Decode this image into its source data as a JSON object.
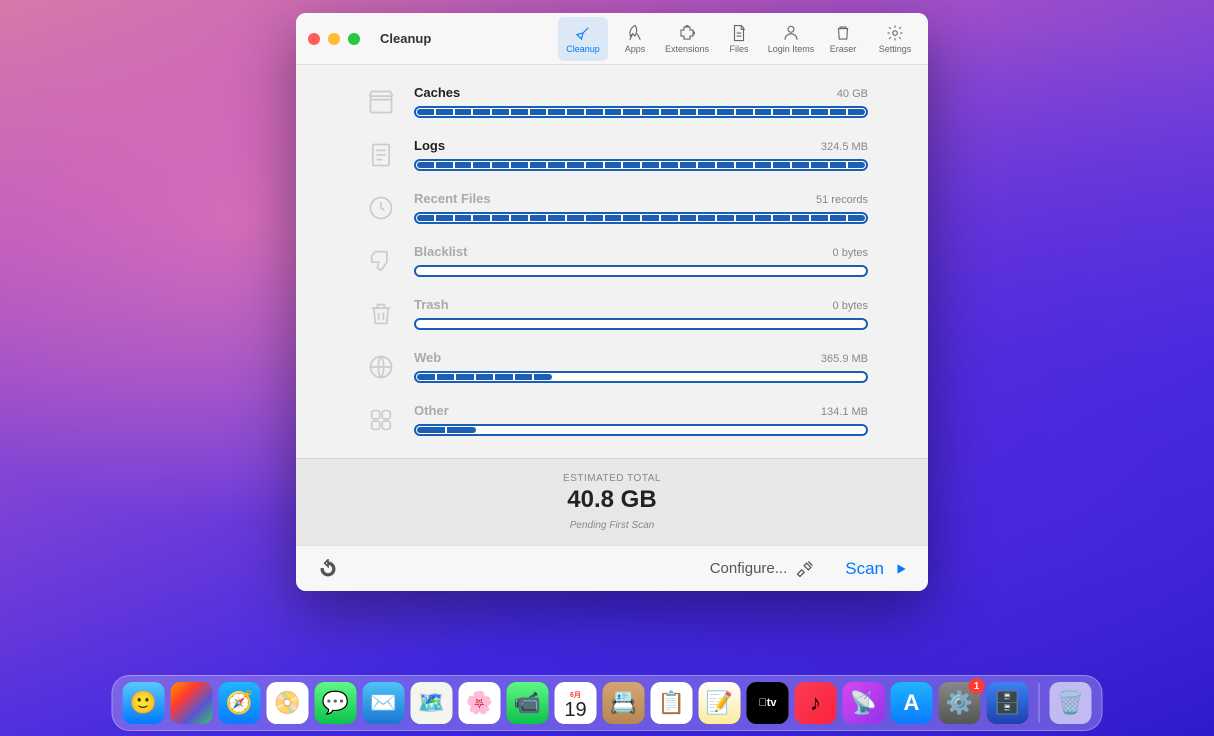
{
  "window": {
    "title": "Cleanup",
    "toolbar": [
      {
        "id": "cleanup",
        "label": "Cleanup",
        "active": true
      },
      {
        "id": "apps",
        "label": "Apps",
        "active": false
      },
      {
        "id": "extensions",
        "label": "Extensions",
        "active": false
      },
      {
        "id": "files",
        "label": "Files",
        "active": false
      },
      {
        "id": "loginitems",
        "label": "Login Items",
        "active": false
      },
      {
        "id": "eraser",
        "label": "Eraser",
        "active": false
      },
      {
        "id": "settings",
        "label": "Settings",
        "active": false
      }
    ]
  },
  "categories": [
    {
      "name": "Caches",
      "size": "40 GB",
      "fill": 100,
      "segments": 24,
      "dim": false
    },
    {
      "name": "Logs",
      "size": "324.5 MB",
      "fill": 100,
      "segments": 24,
      "dim": false
    },
    {
      "name": "Recent Files",
      "size": "51 records",
      "fill": 100,
      "segments": 24,
      "dim": true
    },
    {
      "name": "Blacklist",
      "size": "0 bytes",
      "fill": 0,
      "segments": 0,
      "dim": true
    },
    {
      "name": "Trash",
      "size": "0 bytes",
      "fill": 0,
      "segments": 0,
      "dim": true
    },
    {
      "name": "Web",
      "size": "365.9 MB",
      "fill": 30,
      "segments": 7,
      "dim": true
    },
    {
      "name": "Other",
      "size": "134.1 MB",
      "fill": 13,
      "segments": 2,
      "dim": true
    }
  ],
  "footer": {
    "label": "ESTIMATED TOTAL",
    "total": "40.8 GB",
    "status": "Pending First Scan"
  },
  "actions": {
    "configure": "Configure...",
    "scan": "Scan"
  },
  "dock": {
    "calendar_month": "6月",
    "calendar_day": "19",
    "badge_settings": "1"
  }
}
